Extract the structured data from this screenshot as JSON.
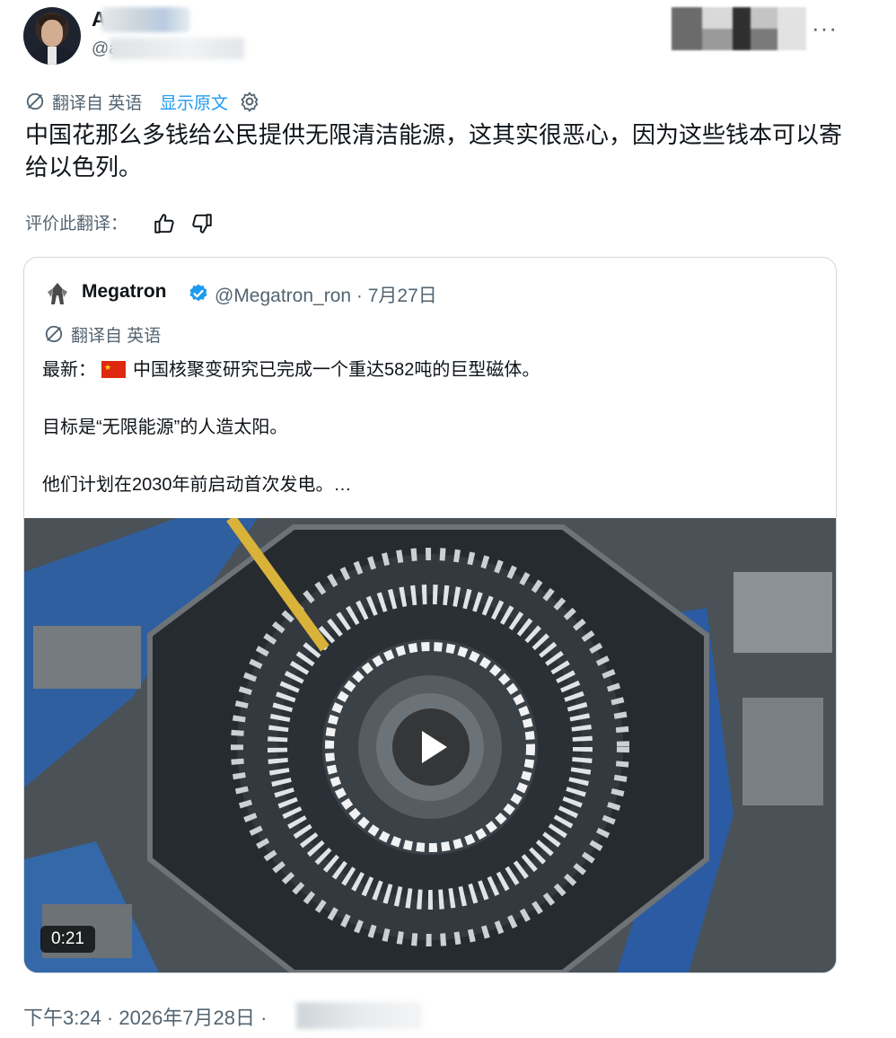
{
  "header": {
    "author_initial": "A",
    "handle_prefix": "@a"
  },
  "more_label": "···",
  "translation": {
    "label": "翻译自 英语",
    "show_original": "显示原文"
  },
  "tweet_text": "中国花那么多钱给公民提供无限清洁能源，这其实很恶心，因为这些钱本可以寄给以色列。",
  "rate_label": "评价此翻译：",
  "quote": {
    "name": "Megatron",
    "handle_date": "@Megatron_ron · 7月27日",
    "translation_label": "翻译自 英语",
    "line1_prefix": "最新：",
    "line1_text": "中国核聚变研究已完成一个重达582吨的巨型磁体。",
    "line2": "目标是“无限能源”的人造太阳。",
    "line3": "他们计划在2030年前启动首次发电。…",
    "video_duration": "0:21"
  },
  "footer": {
    "timestamp": "下午3:24 · 2026年7月28日 ·"
  },
  "colors": {
    "accent": "#1d9bf0",
    "muted": "#536471",
    "border": "#cfd9de",
    "flag_red": "#de2910"
  }
}
